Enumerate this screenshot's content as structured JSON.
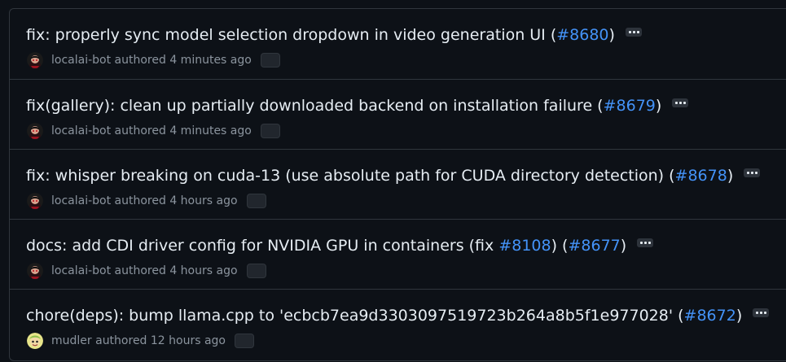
{
  "commits": [
    {
      "title_before": "fix: properly sync model selection dropdown in video generation UI (",
      "pr": "#8680",
      "title_after": ")",
      "author": "localai-bot",
      "action": "authored",
      "time": "4 minutes ago",
      "avatar_icon": "localai-bot-avatar"
    },
    {
      "title_before": "fix(gallery): clean up partially downloaded backend on installation failure (",
      "pr": "#8679",
      "title_after": ")",
      "author": "localai-bot",
      "action": "authored",
      "time": "4 minutes ago",
      "avatar_icon": "localai-bot-avatar"
    },
    {
      "title_before": "fix: whisper breaking on cuda-13 (use absolute path for CUDA directory detection) (",
      "pr": "#8678",
      "title_after": ")",
      "author": "localai-bot",
      "action": "authored",
      "time": "4 hours ago",
      "avatar_icon": "localai-bot-avatar"
    },
    {
      "title_before": "docs: add CDI driver config for NVIDIA GPU in containers (fix ",
      "issue": "#8108",
      "title_middle": ") (",
      "pr": "#8677",
      "title_after": ")",
      "author": "localai-bot",
      "action": "authored",
      "time": "4 hours ago",
      "avatar_icon": "localai-bot-avatar"
    },
    {
      "title_before": "chore(deps): bump llama.cpp to 'ecbcb7ea9d3303097519723b264a8b5f1e977028' (",
      "pr": "#8672",
      "title_after": ")",
      "author": "mudler",
      "action": "authored",
      "time": "12 hours ago",
      "avatar_icon": "mudler-avatar"
    }
  ],
  "colors": {
    "background": "#0d1117",
    "border": "#30363d",
    "text": "#e6edf3",
    "muted": "#8b949e",
    "link": "#4493f8"
  }
}
